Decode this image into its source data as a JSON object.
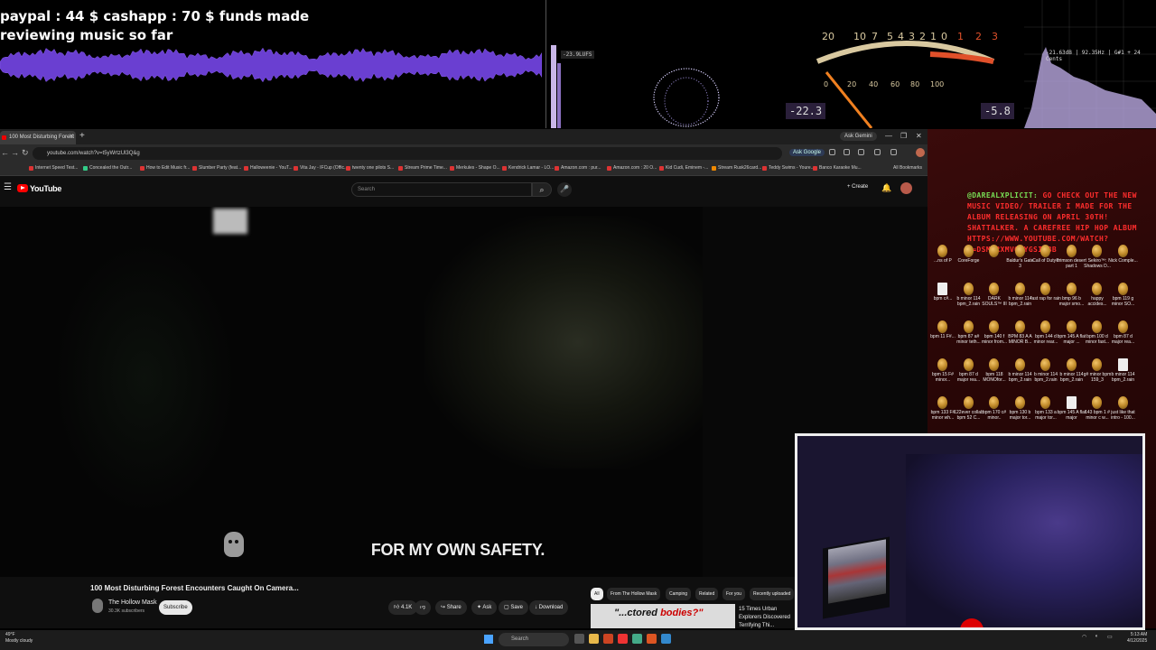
{
  "overlay": {
    "funds_line1": "paypal : 44 $  cashapp : 70 $ funds made",
    "funds_line2": "reviewing music so far",
    "lufs": "-23.9LUFS",
    "vu_scale_top": [
      "20",
      "10",
      "7",
      "5",
      "4",
      "3",
      "2",
      "1",
      "0",
      "1",
      "2",
      "3"
    ],
    "vu_scale_bottom": [
      "0",
      "20",
      "40",
      "60",
      "80",
      "100"
    ],
    "vu_left_value": "-22.3",
    "vu_right_value": "-5.8",
    "spectrum_label": "-21.63dB | 92.35Hz | G#1 + 24 Cents"
  },
  "browser": {
    "tab_title": "100 Most Disturbing Forest",
    "ask_gemini": "Ask Gemini",
    "url": "youtube.com/watch?v=t5yWrtzUl3Q&g",
    "ask_google": "Ask Google",
    "all_bookmarks": "All Bookmarks",
    "bookmarks": [
      "Internet Speed Test...",
      "Concealed the Outr...",
      "How to Edit Music fr...",
      "Slumber Party (feat...",
      "Halloweenie - YouT...",
      "Vita Jay - IFCup (Offic...",
      "twenty one pilots S...",
      "Stream Prime Time...",
      "Merkules - Shape O...",
      "Kendrick Lamar - LO...",
      "Amazon.com : pur...",
      "Amazon.com : 20 O...",
      "Kid Cudi, Eminem -...",
      "Stream Rusk26card...",
      "Teddy Swims - Youre...",
      "Banco Karaoke Mu..."
    ]
  },
  "youtube": {
    "logo": "YouTube",
    "search_placeholder": "Search",
    "create": "+ Create",
    "subtitle": "FOR MY OWN SAFETY.",
    "video_title": "100 Most Disturbing Forest Encounters Caught On Camera...",
    "channel": "The Hollow Mask",
    "subscribers": "30.3K subscribers",
    "subscribe": "Subscribe",
    "likes": "4.1K",
    "share": "Share",
    "ask": "Ask",
    "save": "Save",
    "download": "Download",
    "chips": [
      "All",
      "From The Hollow Mask",
      "Camping",
      "Related",
      "For you",
      "Recently uploaded"
    ],
    "rec_thumb_text_a": "\"...ctored ",
    "rec_thumb_text_b": "bodies?\"",
    "rec_title": "15 Times Urban Explorers Discovered Terrifying Thi..."
  },
  "desktop": {
    "chat_user": "@DAREALXPLICIT:",
    "chat_message": " GO CHECK OUT THE NEW MUSIC VIDEO/ TRAILER I MADE FOR THE ALBUM RELEASING ON APRIL 30TH! SHATTALKER. A CAREFREE HIP HOP ALBUM HTTPS://WWW.YOUTUBE.COM/WATCH?V=DSMGRXMVO5YGSI=BB",
    "icons": [
      [
        "...ns of P",
        "CoreForge",
        "",
        "Baldur's Gate 3",
        "Call of Duty®",
        "crimson desert part 1",
        "Sekiro™: Shadows D...",
        "Nick Comple..."
      ],
      [
        "bpm c#...",
        "b minor 114 bpm_2.rain",
        "DARK SOULS™ III",
        "b minor 114 bpm_2.rain",
        "fast rap for rain",
        "bmp 96 b major smo...",
        "happy accides...",
        "bpm 119 g minor SO..."
      ],
      [
        "bpm 11 F#...",
        "bpm 87 a# minor teth...",
        "bpm 140 f minor from...",
        "BPM 83 A A MINOR B...",
        "bpm 144 d minor rear...",
        "bpm 145 A flat major ...",
        "bpm 100 d minor fast...",
        "bpm 87 d major rea..."
      ],
      [
        "bpm 15 F# minor...",
        "bpm 87 d major rea...",
        "bpm 118 MONOfor...",
        "b minor 114 bpm_2.rain",
        "b minor 114 bpm_2.rain",
        "b minor 114 bpm_2.rain",
        "g# minor bpm 159_3",
        "b minor 114 bpm_2.rain"
      ],
      [
        "bpm 133 F# minor wh...",
        "122ever collab bpm 52 C...",
        "bpm 170 c# minor..",
        "bpm 130 b major tor...",
        "bpm 133 a major tor...",
        "bpm 145 A flat major",
        "143 bpm 1 # minor c w...",
        "just like that intro - 100..."
      ]
    ]
  },
  "taskbar": {
    "weather_temp": "49°F",
    "weather_desc": "Mostly cloudy",
    "search": "Search",
    "time": "5:13 AM",
    "date": "4/12/2025"
  }
}
